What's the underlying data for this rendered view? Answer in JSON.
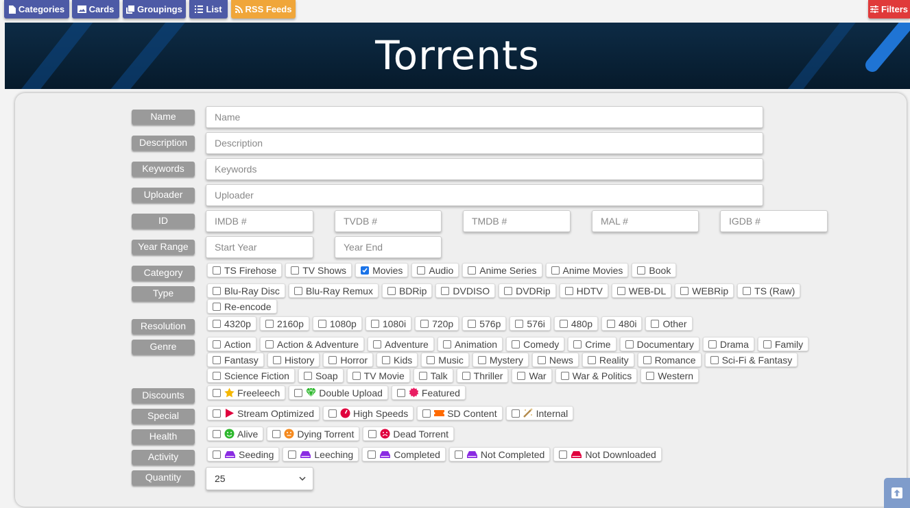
{
  "topbar": {
    "categories": "Categories",
    "cards": "Cards",
    "groupings": "Groupings",
    "list": "List",
    "rss": "RSS Feeds",
    "filters": "Filters"
  },
  "banner": {
    "title": "Torrents"
  },
  "labels": {
    "name": "Name",
    "description": "Description",
    "keywords": "Keywords",
    "uploader": "Uploader",
    "id": "ID",
    "year_range": "Year Range",
    "category": "Category",
    "type": "Type",
    "resolution": "Resolution",
    "genre": "Genre",
    "discounts": "Discounts",
    "special": "Special",
    "health": "Health",
    "activity": "Activity",
    "quantity": "Quantity"
  },
  "placeholders": {
    "name": "Name",
    "description": "Description",
    "keywords": "Keywords",
    "uploader": "Uploader",
    "imdb": "IMDB #",
    "tvdb": "TVDB #",
    "tmdb": "TMDB #",
    "mal": "MAL #",
    "igdb": "IGDB #",
    "start_year": "Start Year",
    "year_end": "Year End"
  },
  "category": [
    {
      "label": "TS Firehose",
      "checked": false
    },
    {
      "label": "TV Shows",
      "checked": false
    },
    {
      "label": "Movies",
      "checked": true
    },
    {
      "label": "Audio",
      "checked": false
    },
    {
      "label": "Anime Series",
      "checked": false
    },
    {
      "label": "Anime Movies",
      "checked": false
    },
    {
      "label": "Book",
      "checked": false
    }
  ],
  "type": [
    "Blu-Ray Disc",
    "Blu-Ray Remux",
    "BDRip",
    "DVDISO",
    "DVDRip",
    "HDTV",
    "WEB-DL",
    "WEBRip",
    "TS (Raw)",
    "Re-encode"
  ],
  "resolution": [
    "4320p",
    "2160p",
    "1080p",
    "1080i",
    "720p",
    "576p",
    "576i",
    "480p",
    "480i",
    "Other"
  ],
  "genre": [
    "Action",
    "Action & Adventure",
    "Adventure",
    "Animation",
    "Comedy",
    "Crime",
    "Documentary",
    "Drama",
    "Family",
    "Fantasy",
    "History",
    "Horror",
    "Kids",
    "Music",
    "Mystery",
    "News",
    "Reality",
    "Romance",
    "Sci-Fi & Fantasy",
    "Science Fiction",
    "Soap",
    "TV Movie",
    "Talk",
    "Thriller",
    "War",
    "War & Politics",
    "Western"
  ],
  "discounts": [
    {
      "label": "Freeleech",
      "icon": "star-icon",
      "color": "#f5b700"
    },
    {
      "label": "Double Upload",
      "icon": "gem-icon",
      "color": "#2eb82e"
    },
    {
      "label": "Featured",
      "icon": "certificate-icon",
      "color": "#e91e63"
    }
  ],
  "special": [
    {
      "label": "Stream Optimized",
      "icon": "play-icon",
      "color": "#e0003d"
    },
    {
      "label": "High Speeds",
      "icon": "speedometer-icon",
      "color": "#e0003d"
    },
    {
      "label": "SD Content",
      "icon": "ticket-icon",
      "color": "#ff6a00"
    },
    {
      "label": "Internal",
      "icon": "magic-wand-icon",
      "color": "#b38b4d"
    }
  ],
  "health": [
    {
      "label": "Alive",
      "icon": "smile-icon",
      "color": "#2eb82e"
    },
    {
      "label": "Dying Torrent",
      "icon": "meh-icon",
      "color": "#f58a1f"
    },
    {
      "label": "Dead Torrent",
      "icon": "frown-icon",
      "color": "#e0003d"
    }
  ],
  "activity": [
    {
      "label": "Seeding",
      "icon": "hdd-icon",
      "color": "#8a2be2"
    },
    {
      "label": "Leeching",
      "icon": "hdd-icon",
      "color": "#8a2be2"
    },
    {
      "label": "Completed",
      "icon": "hdd-icon",
      "color": "#8a2be2"
    },
    {
      "label": "Not Completed",
      "icon": "hdd-icon",
      "color": "#8a2be2"
    },
    {
      "label": "Not Downloaded",
      "icon": "hdd-icon",
      "color": "#e0003d"
    }
  ],
  "quantity": {
    "value": "25"
  }
}
